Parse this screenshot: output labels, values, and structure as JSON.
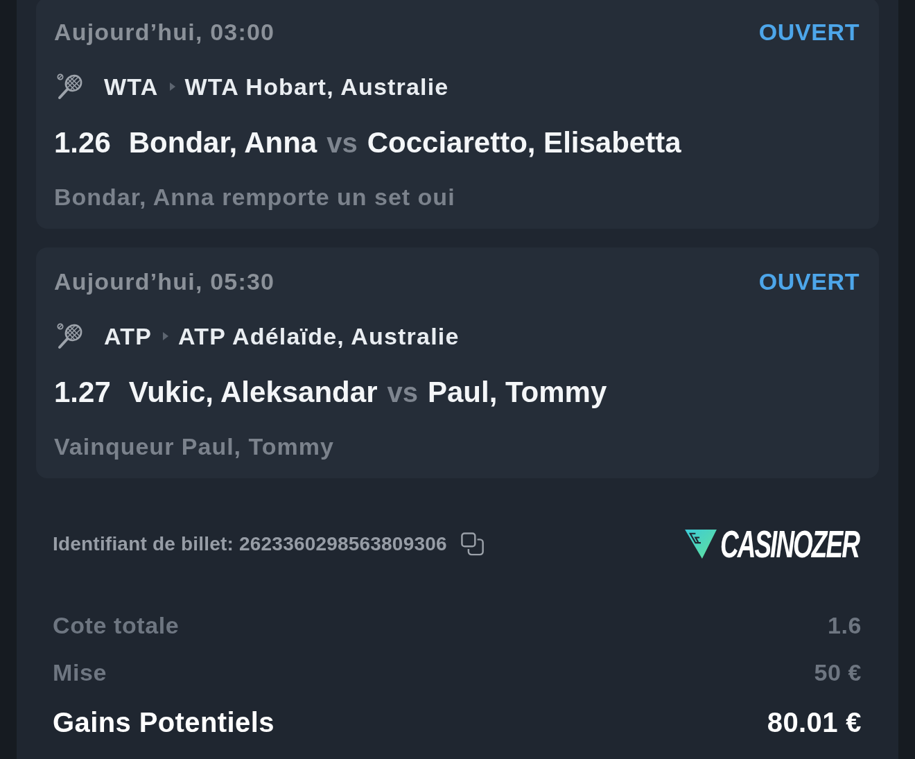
{
  "bets": [
    {
      "date": "Aujourd’hui, 03:00",
      "status": {
        "label": "OUVERT",
        "kind": "open"
      },
      "tour": "WTA",
      "tournament": "WTA Hobart, Australie",
      "odds": "1.26",
      "home": "Bondar, Anna",
      "separator": "vs",
      "away": "Cocciaretto, Elisabetta",
      "selection": "Bondar, Anna remporte un set oui"
    },
    {
      "date": "Aujourd’hui, 05:30",
      "status": {
        "label": "OUVERT",
        "kind": "open"
      },
      "tour": "ATP",
      "tournament": "ATP Adélaïde, Australie",
      "odds": "1.27",
      "home": "Vukic, Aleksandar",
      "separator": "vs",
      "away": "Paul, Tommy",
      "selection": "Vainqueur Paul, Tommy"
    }
  ],
  "ticket": {
    "id_text": "Identifiant de billet: 2623360298563809306",
    "brand": "CASINOZER"
  },
  "summary": [
    {
      "label": "Cote totale",
      "value": "1.6",
      "kind": "muted"
    },
    {
      "label": "Mise",
      "value": "50 €",
      "kind": "muted"
    },
    {
      "label": "Gains Potentiels",
      "value": "80.01 €",
      "kind": "total"
    }
  ]
}
